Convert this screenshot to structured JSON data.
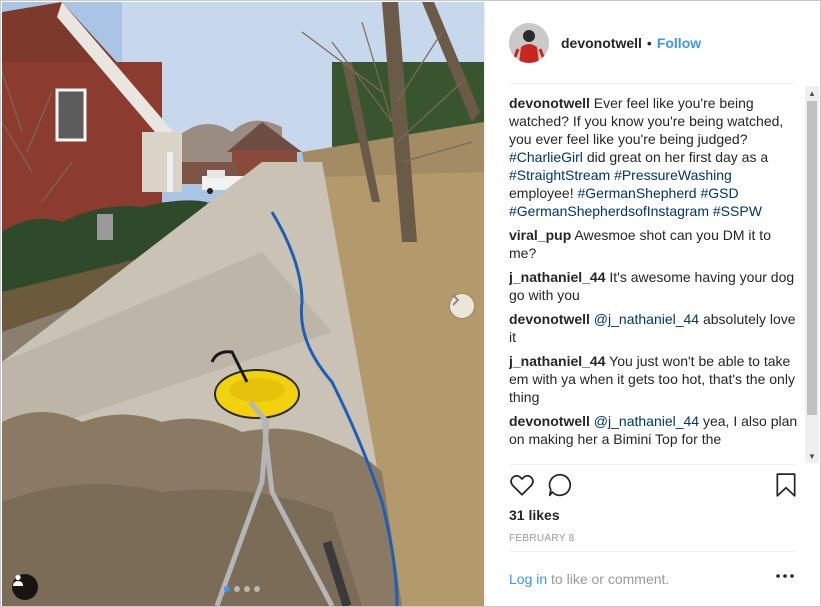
{
  "post": {
    "username": "devonotwell",
    "separator": "•",
    "follow_label": "Follow",
    "likes": "31 likes",
    "date": "FEBRUARY 8",
    "login_link": "Log in",
    "login_suffix": " to like or comment.",
    "carousel": {
      "count": 4,
      "active": 0
    }
  },
  "caption": {
    "author": "devonotwell",
    "text": "Ever feel like you're being watched? If you know you're being watched, you ever feel like you're being judged?",
    "tag1": "#CharlieGirl",
    "text2": "did great on her first day as a",
    "tag2": "#StraightStream",
    "tag3": "#PressureWashing",
    "text3": "employee!",
    "tag4": "#GermanShepherd",
    "tag5": "#GSD",
    "tag6": "#GermanShepherdsofInstagram",
    "tag7": "#SSPW"
  },
  "comments": [
    {
      "author": "viral_pup",
      "text": "Awesmoe shot can you DM it to me?"
    },
    {
      "author": "j_nathaniel_44",
      "text": "It's awesome having your dog go with you"
    },
    {
      "author": "devonotwell",
      "mention": "@j_nathaniel_44",
      "text": "absolutely love it"
    },
    {
      "author": "j_nathaniel_44",
      "text": "You just won't be able to take em with ya when it gets too hot, that's the only thing"
    },
    {
      "author": "devonotwell",
      "mention": "@j_nathaniel_44",
      "text": "yea, I also plan on making her a Bimini Top for the"
    }
  ],
  "icons": {
    "like": "heart-icon",
    "comment": "comment-bubble-icon",
    "save": "bookmark-icon",
    "more": "more-options-icon",
    "next": "chevron-right-icon",
    "tag": "user-tag-icon"
  },
  "colors": {
    "link_blue": "#3897f0",
    "hashtag": "#003569",
    "text": "#262626",
    "muted": "#999999"
  }
}
